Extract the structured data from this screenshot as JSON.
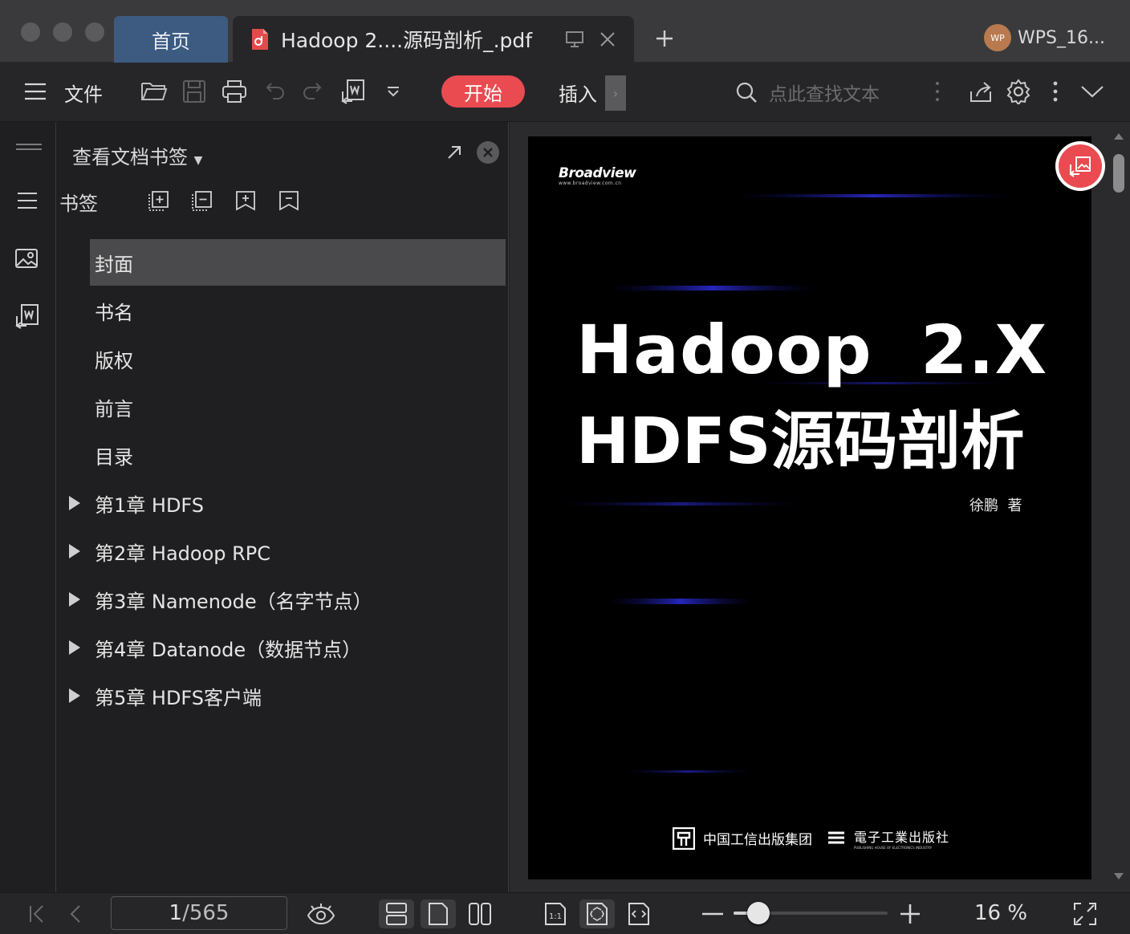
{
  "tabs": {
    "home_label": "首页",
    "doc_title": "Hadoop 2....源码剖析_.pdf"
  },
  "user": {
    "avatar_text": "WP",
    "name": "WPS_16..."
  },
  "toolbar": {
    "file_label": "文件",
    "start_label": "开始",
    "insert_label": "插入",
    "search_placeholder": "点此查找文本"
  },
  "sidebar": {
    "title": "查看文档书签",
    "bookmarks_label": "书签",
    "items": [
      {
        "label": "封面",
        "expandable": false,
        "selected": true
      },
      {
        "label": "书名",
        "expandable": false,
        "selected": false
      },
      {
        "label": "版权",
        "expandable": false,
        "selected": false
      },
      {
        "label": "前言",
        "expandable": false,
        "selected": false
      },
      {
        "label": "目录",
        "expandable": false,
        "selected": false
      },
      {
        "label": "第1章 HDFS",
        "expandable": true,
        "selected": false
      },
      {
        "label": "第2章 Hadoop RPC",
        "expandable": true,
        "selected": false
      },
      {
        "label": "第3章 Namenode（名字节点）",
        "expandable": true,
        "selected": false
      },
      {
        "label": "第4章 Datanode（数据节点）",
        "expandable": true,
        "selected": false
      },
      {
        "label": "第5章 HDFS客户端",
        "expandable": true,
        "selected": false
      }
    ]
  },
  "cover": {
    "brand": "Broadview",
    "brand_url": "www.broadview.com.cn",
    "title_line1": "Hadoop  2.X",
    "title_line2": "HDFS源码剖析",
    "author": "徐鹏  著",
    "publisher1": "中国工信出版集团",
    "publisher2": "電子工業出版社",
    "publisher2_en": "PUBLISHING HOUSE OF ELECTRONICS INDUSTRY"
  },
  "status": {
    "current_page": "1",
    "total_pages": "/565",
    "zoom": "16 %",
    "zoom_level": 0.16
  },
  "colors": {
    "accent": "#e94b51",
    "home_tab": "#3d5a80",
    "selected_item": "#4a4a4c"
  }
}
